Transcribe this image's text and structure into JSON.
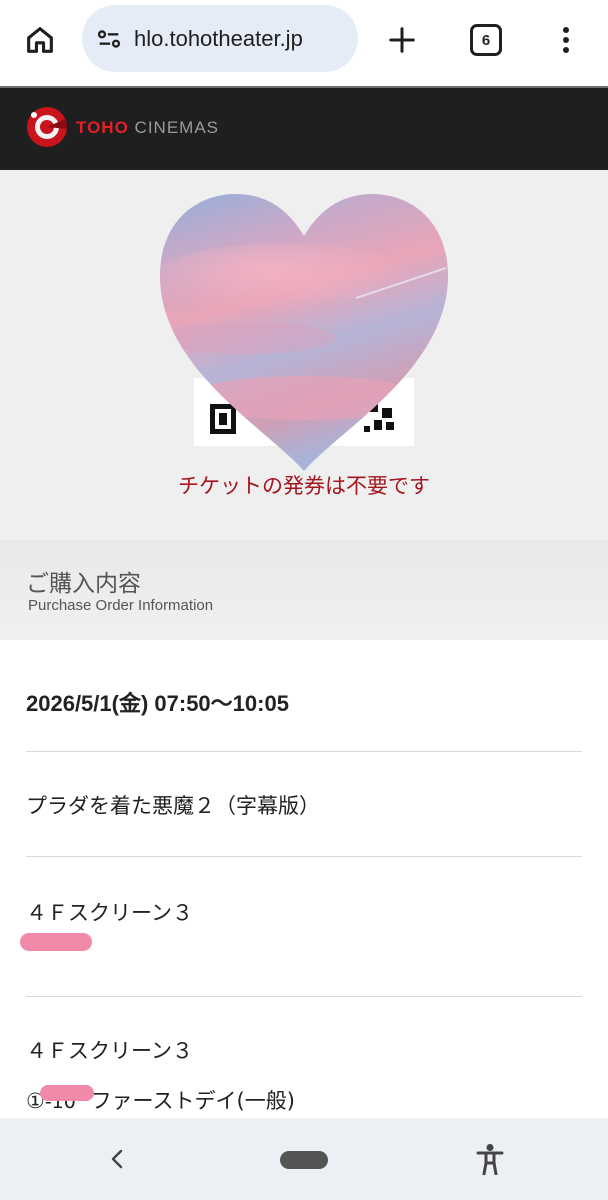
{
  "browser": {
    "url": "hlo.tohotheater.jp",
    "tab_count": "6",
    "icons": [
      "home-icon",
      "page-info-icon",
      "new-tab-icon",
      "tab-switcher-icon",
      "overflow-menu-icon"
    ]
  },
  "site": {
    "logo_red": "TOHO",
    "logo_gray": "CINEMAS",
    "brand_color": "#e3202a"
  },
  "ticket": {
    "notice": "チケットの発券は不要です",
    "notice_color": "#a3171e"
  },
  "section": {
    "title": "ご購入内容",
    "subtitle": "Purchase Order Information"
  },
  "order": {
    "datetime": "2026/5/1(金) 07:50〜10:05",
    "movie": "プラダを着た悪魔２（字幕版）",
    "screen": "４Ｆスクリーン３",
    "seat_visible": "-10",
    "ticket_screen": "４Ｆスクリーン３",
    "ticket_prefix": "①",
    "ticket_seat_visible": "-10",
    "ticket_type": "ファーストデイ(一般)"
  },
  "nav": {
    "icons": [
      "back-icon",
      "home-pill",
      "accessibility-icon"
    ]
  }
}
